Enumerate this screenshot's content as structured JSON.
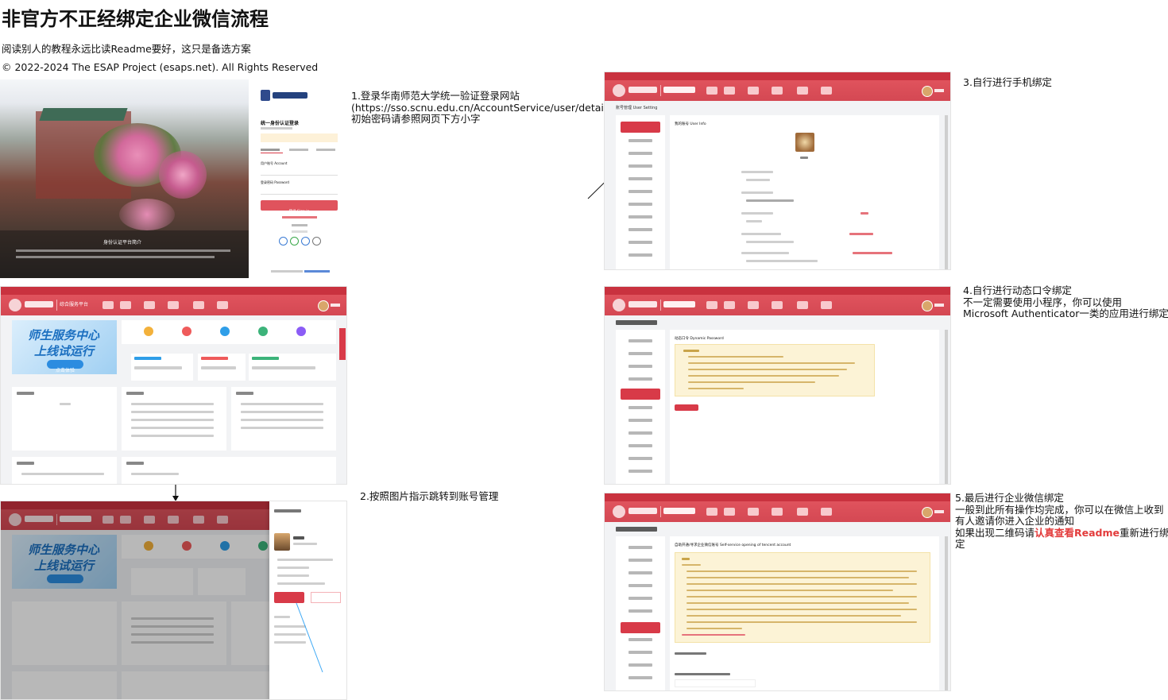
{
  "page": {
    "title": "非官方不正经绑定企业微信流程",
    "subtitle": "阅读别人的教程永远比读Readme要好，这只是备选方案",
    "copyright": "© 2022-2024 The ESAP Project (esaps.net). All Rights Reserved"
  },
  "steps": {
    "step1": {
      "line1": "1.登录华南师范大学统一验证登录网站",
      "line2": "(https://sso.scnu.edu.cn/AccountService/user/detail.html)",
      "line3": "初始密码请参照网页下方小字"
    },
    "step2": {
      "line1": "2.按照图片指示跳转到账号管理"
    },
    "step3": {
      "line1": "3.自行进行手机绑定"
    },
    "step4": {
      "line1": "4.自行进行动态口令绑定",
      "line2": "不一定需要使用小程序，你可以使用",
      "line3": "Microsoft Authenticator一类的应用进行绑定操作"
    },
    "step5": {
      "line1": "5.最后进行企业微信绑定",
      "line2": "一般到此所有操作均完成，你可以在微信上收到",
      "line3": "有人邀请你进入企业的通知",
      "line4_prefix": "如果出现二维码请",
      "line4_highlight": "认真查看Readme",
      "line4_suffix": "重新进行绑",
      "line5": "定"
    }
  },
  "screenshots": {
    "login": {
      "heading": "统一身份认证登录",
      "username_label": "用户账号 Account",
      "password_label": "登录密码 Password",
      "login_button": "登录 Sign in",
      "campus_caption": "身份认证平台简介"
    },
    "portal": {
      "platform_name": "综合服务平台",
      "banner_line1": "师生服务中心",
      "banner_line2": "上线试运行",
      "banner_button": "点击体验"
    },
    "account": {
      "setting_title": "账号管理 User Setting",
      "my_account": "我的账号 User Info",
      "dynamic_password": "动态口令 Dynamic Password",
      "wecom_binding": "自助开通/寻求企业微信账号 Self-service opening of tencent account"
    }
  },
  "colors": {
    "brand_red": "#d44853",
    "highlight_red": "#e33b3b",
    "notice_yellow": "#fcf3d6"
  }
}
